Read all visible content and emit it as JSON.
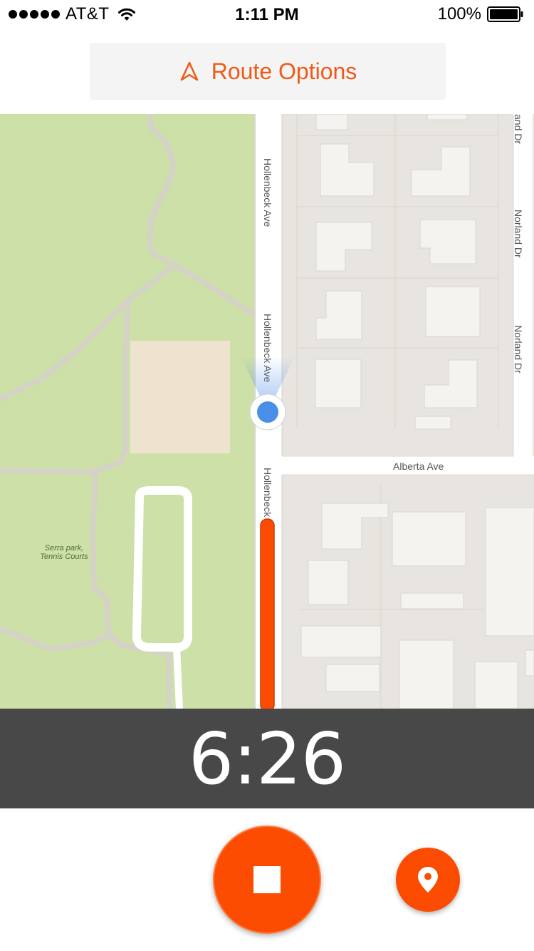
{
  "status_bar": {
    "carrier": "AT&T",
    "time": "1:11 PM",
    "battery": "100%",
    "signal_icon": "signal-dots-icon",
    "wifi_icon": "wifi-icon",
    "battery_icon": "battery-full-icon"
  },
  "header": {
    "route_options_label": "Route Options",
    "route_icon": "navigation-arrow-icon"
  },
  "map": {
    "street_labels": {
      "hollenbeck_1": "Hollenbeck Ave",
      "hollenbeck_2": "Hollenbeck Ave",
      "hollenbeck_3": "Hollenbeck",
      "norland_1": "and Dr",
      "norland_2": "Norland Dr",
      "norland_3": "Norland Dr",
      "alberta": "Alberta Ave"
    },
    "poi": {
      "line1": "Serra park,",
      "line2": "Tennis Courts"
    },
    "colors": {
      "park": "#cde0a8",
      "blocks": "#e9e6e1",
      "buildings": "#f4f3ef",
      "route": "#fc4c02",
      "location": "#4a8fe7"
    }
  },
  "timer": {
    "value": "6:26"
  },
  "controls": {
    "stop_icon": "stop-icon",
    "pin_icon": "location-pin-icon",
    "accent": "#fc4c02"
  }
}
